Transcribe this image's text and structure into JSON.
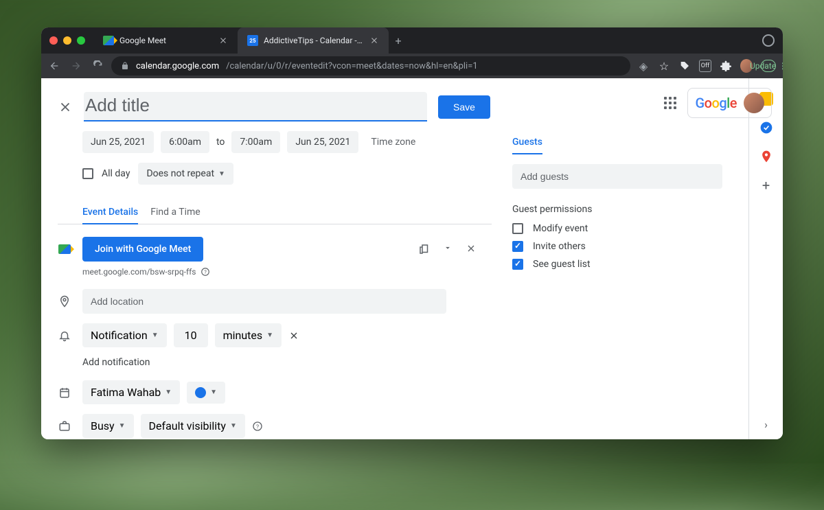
{
  "browser": {
    "tabs": [
      {
        "title": "Google Meet",
        "active": false
      },
      {
        "title": "AddictiveTips - Calendar - Eve...",
        "active": true
      }
    ],
    "url_host": "calendar.google.com",
    "url_path": "/calendar/u/0/r/eventedit?vcon=meet&dates=now&hl=en&pli=1",
    "update_label": "Update"
  },
  "header": {
    "title_placeholder": "Add title",
    "title_value": "",
    "save_label": "Save",
    "google_logo": "Google"
  },
  "datetime": {
    "start_date": "Jun 25, 2021",
    "start_time": "6:00am",
    "to_label": "to",
    "end_time": "7:00am",
    "end_date": "Jun 25, 2021",
    "timezone_label": "Time zone",
    "allday_label": "All day",
    "repeat_label": "Does not repeat"
  },
  "tabs2": {
    "details": "Event Details",
    "findtime": "Find a Time"
  },
  "meet": {
    "button": "Join with Google Meet",
    "url": "meet.google.com/bsw-srpq-ffs"
  },
  "location": {
    "placeholder": "Add location"
  },
  "notification": {
    "type": "Notification",
    "value": "10",
    "unit": "minutes",
    "add_label": "Add notification"
  },
  "calendar": {
    "name": "Fatima Wahab",
    "busy": "Busy",
    "visibility": "Default visibility"
  },
  "guests": {
    "tab_label": "Guests",
    "placeholder": "Add guests",
    "perm_title": "Guest permissions",
    "perms": [
      {
        "label": "Modify event",
        "checked": false
      },
      {
        "label": "Invite others",
        "checked": true
      },
      {
        "label": "See guest list",
        "checked": true
      }
    ]
  }
}
